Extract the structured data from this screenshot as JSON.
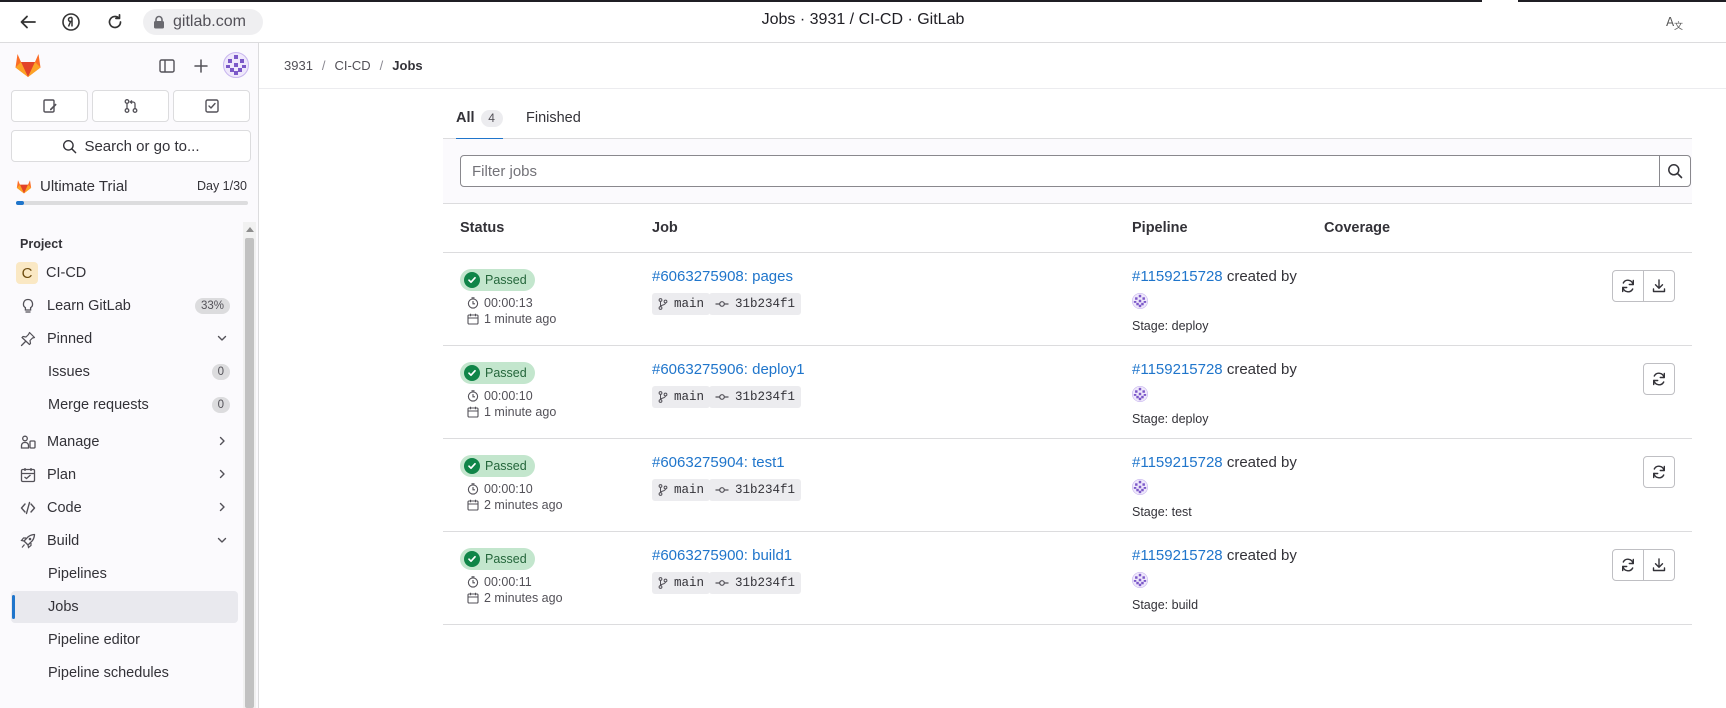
{
  "browser": {
    "url": "gitlab.com",
    "window_title": "Jobs · 3931 / CI-CD · GitLab"
  },
  "sidebar": {
    "search_label": "Search or go to...",
    "trial": {
      "label": "Ultimate Trial",
      "day": "Day 1/30",
      "progress": 0.033
    },
    "section_label": "Project",
    "project_initial": "C",
    "project_name": "CI-CD",
    "learn": {
      "label": "Learn GitLab",
      "badge": "33%"
    },
    "pinned": {
      "label": "Pinned",
      "items": [
        {
          "label": "Issues",
          "count": "0"
        },
        {
          "label": "Merge requests",
          "count": "0"
        }
      ]
    },
    "groups": [
      {
        "label": "Manage"
      },
      {
        "label": "Plan"
      },
      {
        "label": "Code"
      },
      {
        "label": "Build"
      }
    ],
    "build_items": [
      {
        "label": "Pipelines"
      },
      {
        "label": "Jobs"
      },
      {
        "label": "Pipeline editor"
      },
      {
        "label": "Pipeline schedules"
      }
    ]
  },
  "breadcrumb": {
    "items": [
      "3931",
      "CI-CD",
      "Jobs"
    ]
  },
  "tabs": [
    {
      "label": "All",
      "count": "4"
    },
    {
      "label": "Finished"
    }
  ],
  "filter": {
    "placeholder": "Filter jobs"
  },
  "table": {
    "headers": {
      "status": "Status",
      "job": "Job",
      "pipeline": "Pipeline",
      "coverage": "Coverage"
    },
    "rows": [
      {
        "status": "Passed",
        "duration": "00:00:13",
        "finished": "1 minute ago",
        "job": "#6063275908: pages",
        "branch": "main",
        "commit": "31b234f1",
        "pipeline": "#1159215728",
        "created_by": "created by",
        "stage": "Stage: deploy"
      },
      {
        "status": "Passed",
        "duration": "00:00:10",
        "finished": "1 minute ago",
        "job": "#6063275906: deploy1",
        "branch": "main",
        "commit": "31b234f1",
        "pipeline": "#1159215728",
        "created_by": "created by",
        "stage": "Stage: deploy"
      },
      {
        "status": "Passed",
        "duration": "00:00:10",
        "finished": "2 minutes ago",
        "job": "#6063275904: test1",
        "branch": "main",
        "commit": "31b234f1",
        "pipeline": "#1159215728",
        "created_by": "created by",
        "stage": "Stage: test"
      },
      {
        "status": "Passed",
        "duration": "00:00:11",
        "finished": "2 minutes ago",
        "job": "#6063275900: build1",
        "branch": "main",
        "commit": "31b234f1",
        "pipeline": "#1159215728",
        "created_by": "created by",
        "stage": "Stage: build"
      }
    ]
  },
  "colors": {
    "link": "#1f75cb",
    "success": "#108548",
    "success_bg": "#c3e6cd",
    "tanuki": "#e24329"
  },
  "icons": [
    "back-icon",
    "yandex-icon",
    "reload-icon",
    "lock-icon",
    "translate-icon",
    "tanuki-logo",
    "sidebar-toggle-icon",
    "plus-icon",
    "user-avatar",
    "issues-icon",
    "merge-request-icon",
    "todo-icon",
    "search-icon",
    "lightbulb-icon",
    "pin-icon",
    "manage-icon",
    "plan-icon",
    "code-icon",
    "rocket-icon",
    "chevron-down-icon",
    "chevron-right-icon",
    "check-icon",
    "timer-icon",
    "calendar-icon",
    "branch-icon",
    "commit-icon",
    "retry-icon",
    "download-icon"
  ]
}
